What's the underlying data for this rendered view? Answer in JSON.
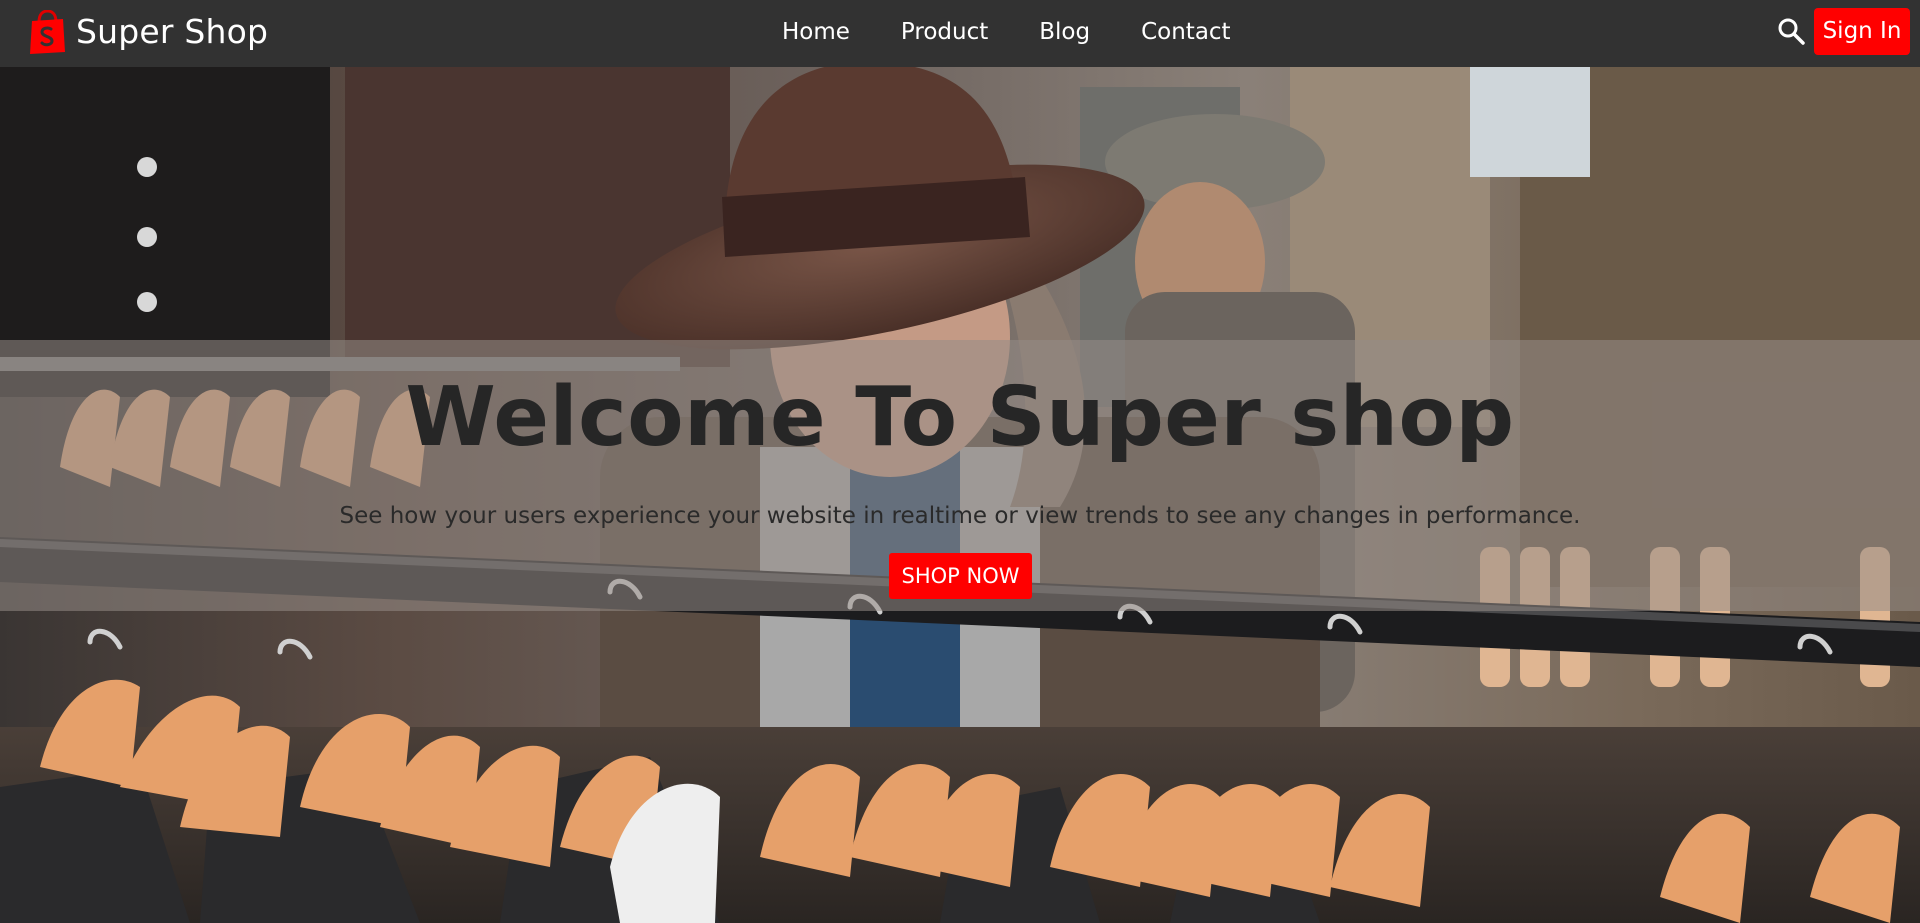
{
  "navbar": {
    "brand_icon": "shopify-bag-icon",
    "brand_name": "Super Shop",
    "links": [
      "Home",
      "Product",
      "Blog",
      "Contact"
    ],
    "search_icon": "search-icon",
    "signin_label": "Sign In"
  },
  "hero": {
    "background_image": "clothing-rack-man-in-hat-photo",
    "title": "Welcome To Super shop",
    "subtitle": "See how your users experience your website in realtime or view trends to see any changes in performance.",
    "cta_label": "SHOP NOW"
  },
  "colors": {
    "navbar_bg": "#323232",
    "accent": "#ff0000",
    "text_dark": "#262626",
    "text_light": "#ffffff"
  }
}
